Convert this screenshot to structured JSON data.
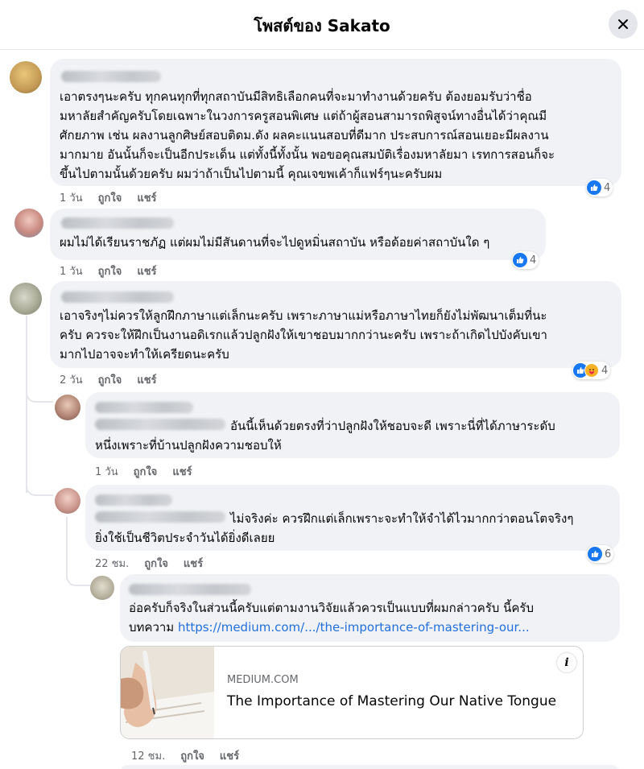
{
  "header": {
    "title": "โพสต์ของ Sakato"
  },
  "comments": [
    {
      "lines": [
        "เอาตรงๆนะครับ ทุกคนทุกที่ทุกสถาบันมีสิทธิเลือกคนที่จะมาทำงานด้วยครับ ต้องยอมรับว่าชื่อ",
        "มหาลัยสำคัญครับโดยเฉพาะในวงการครูสอนพิเศษ แต่ถ้าผู้สอนสามารถพิสูจน์ทางอื่นได้ว่าคุณมี",
        "ศักยภาพ เช่น ผลงานลูกศิษย์สอบติดม.ดัง ผลคะแนนสอบที่ดีมาก ประสบการณ์สอนเยอะมีผลงาน",
        "มากมาย อันนั้นก็จะเป็นอีกประเด็น แต่ทั้งนี้ทั้งนั้น พอขอคุณสมบัติเรื่องมหาลัยมา เรทการสอนก็จะ",
        "ขึ้นไปตามนั้นด้วยครับ ผมว่าถ้าเป็นไปตามนี้ คุณเจขพเค้าก็แฟร์ๆนะครับผม"
      ],
      "time": "1 วัน",
      "like": "ถูกใจ",
      "share": "แชร์",
      "reactions": "4"
    },
    {
      "lines": [
        "ผมไม่ได้เรียนราชภัฏ แต่ผมไม่มีสันดานที่จะไปดูหมิ่นสถาบัน หรือด้อยค่าสถาบันใด ๆ"
      ],
      "time": "1 วัน",
      "like": "ถูกใจ",
      "share": "แชร์",
      "reactions": "4"
    },
    {
      "lines": [
        "เอาจริงๆไม่ควรให้ลูกฝึกภาษาแต่เล็กนะครับ เพราะภาษาแม่หรือภาษาไทยก็ยังไม่พัฒนาเต็มที่นะ",
        "ครับ ควรจะให้ฝึกเป็นงานอดิเรกแล้วปลูกฝังให้เขาชอบมากกว่านะครับ เพราะถ้าเกิดไปบังคับเขา",
        "มากไปอาจจะทำให้เครียดนะครับ"
      ],
      "time": "2 วัน",
      "like": "ถูกใจ",
      "share": "แชร์",
      "reactions": "4"
    },
    {
      "lines": [
        "อันนี้เห็นด้วยตรงที่ว่าปลูกฝังให้ชอบจะดี เพราะนี่ที่ได้ภาษาระดับ",
        "หนึ่งเพราะที่บ้านปลูกฝังความชอบให้"
      ],
      "time": "1 วัน",
      "like": "ถูกใจ",
      "share": "แชร์"
    },
    {
      "lines": [
        "ไม่จริงค่ะ ควรฝึกแต่เล็กเพราะจะทำให้จำได้ไวมากกว่าตอนโตจริงๆ",
        "ยิ่งใช้เป็นชีวิตประจำวันได้ยิ่งดีเลยย"
      ],
      "time": "22 ชม.",
      "like": "ถูกใจ",
      "share": "แชร์",
      "reactions": "6"
    },
    {
      "line1": "อ่อครับก็จริงในส่วนนี้ครับแต่ตามงานวิจัยแล้วควรเป็นแบบที่ผมกล่าวครับ นี้ครับ",
      "line2_prefix": "บทความ ",
      "link": "https://medium.com/.../the-importance-of-mastering-our...",
      "time": "12 ชม.",
      "like": "ถูกใจ",
      "share": "แชร์"
    }
  ],
  "link_card": {
    "domain": "MEDIUM.COM",
    "title": "The Importance of Mastering Our Native Tongue",
    "info": "i"
  },
  "colors": {
    "like": "#1877f2",
    "link": "#216fdb",
    "bubble": "#f0f2f5"
  }
}
